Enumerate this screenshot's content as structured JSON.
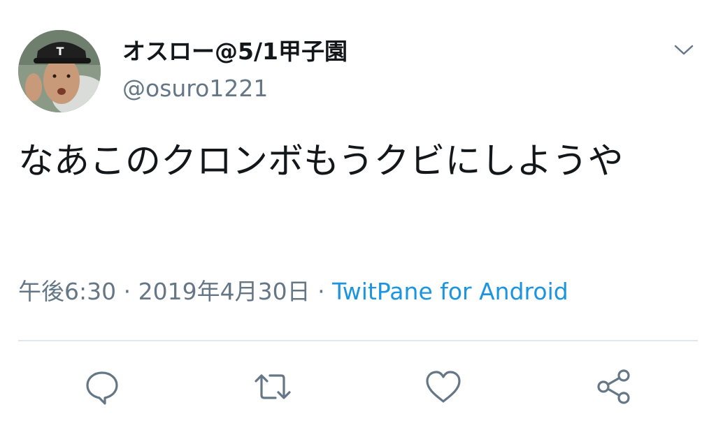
{
  "author": {
    "display_name": "オスロー@5/1甲子園",
    "handle": "@osuro1221",
    "avatar_icon": "user-avatar"
  },
  "tweet": {
    "text": "なあこのクロンボもうクビにしようや",
    "time": "午後6:30",
    "separator": "·",
    "date": "2019年4月30日",
    "source": "TwitPane for Android"
  },
  "actions": {
    "reply_icon": "reply-icon",
    "retweet_icon": "retweet-icon",
    "like_icon": "heart-icon",
    "share_icon": "share-icon"
  },
  "colors": {
    "text": "#14171a",
    "secondary": "#657786",
    "link": "#1b95e0",
    "divider": "#e1e8ed"
  }
}
